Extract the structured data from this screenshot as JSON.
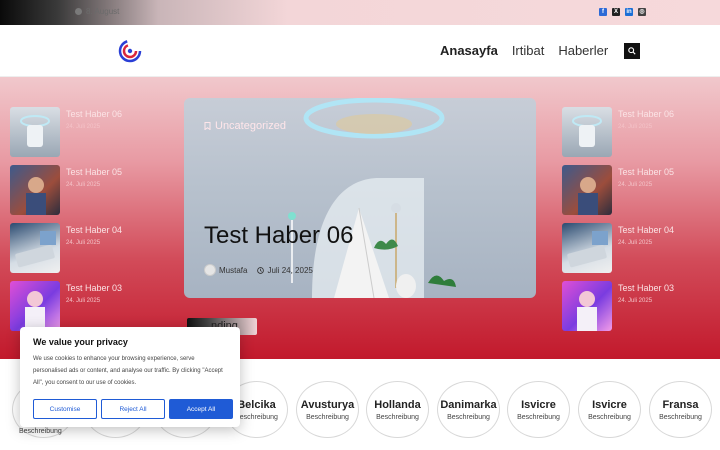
{
  "topbar": {
    "date": "8. August",
    "social": [
      {
        "icon": "facebook-icon",
        "color": "#2d6ad6",
        "glyph": "f"
      },
      {
        "icon": "x-icon",
        "color": "#222222",
        "glyph": "X"
      },
      {
        "icon": "linkedin-icon",
        "color": "#1c6fd6",
        "glyph": "in"
      },
      {
        "icon": "instagram-icon",
        "color": "#444444",
        "glyph": "◎"
      }
    ]
  },
  "nav": {
    "home": "Anasayfa",
    "contact": "Irtibat",
    "news": "Haberler"
  },
  "side_left": [
    {
      "title": "Test Haber 06",
      "date": "24. Juli 2025"
    },
    {
      "title": "Test Haber 05",
      "date": "24. Juli 2025"
    },
    {
      "title": "Test Haber 04",
      "date": "24. Juli 2025"
    },
    {
      "title": "Test Haber 03",
      "date": "24. Juli 2025"
    }
  ],
  "side_right": [
    {
      "title": "Test Haber 06",
      "date": "24. Juli 2025"
    },
    {
      "title": "Test Haber 05",
      "date": "24. Juli 2025"
    },
    {
      "title": "Test Haber 04",
      "date": "24. Juli 2025"
    },
    {
      "title": "Test Haber 03",
      "date": "24. Juli 2025"
    }
  ],
  "featured": {
    "category": "Uncategorized",
    "title": "Test Haber 06",
    "author": "Mustafa",
    "date": "Juli 24, 2025"
  },
  "trending_label": "nding",
  "countries": [
    {
      "name": "",
      "sub": "Beschreibung"
    },
    {
      "name": "",
      "sub": ""
    },
    {
      "name": "",
      "sub": ""
    },
    {
      "name": "Belcika",
      "sub": "Beschreibung"
    },
    {
      "name": "Avusturya",
      "sub": "Beschreibung"
    },
    {
      "name": "Hollanda",
      "sub": "Beschreibung"
    },
    {
      "name": "Danimarka",
      "sub": "Beschreibung"
    },
    {
      "name": "Isvicre",
      "sub": "Beschreibung"
    },
    {
      "name": "Isvicre",
      "sub": "Beschreibung"
    },
    {
      "name": "Fransa",
      "sub": "Beschreibung"
    }
  ],
  "cookie": {
    "title": "We value your privacy",
    "body": "We use cookies to enhance your browsing experience, serve personalised ads or content, and analyse our traffic. By clicking \"Accept All\", you consent to our use of cookies.",
    "customise": "Customise",
    "reject": "Reject All",
    "accept": "Accept All"
  }
}
